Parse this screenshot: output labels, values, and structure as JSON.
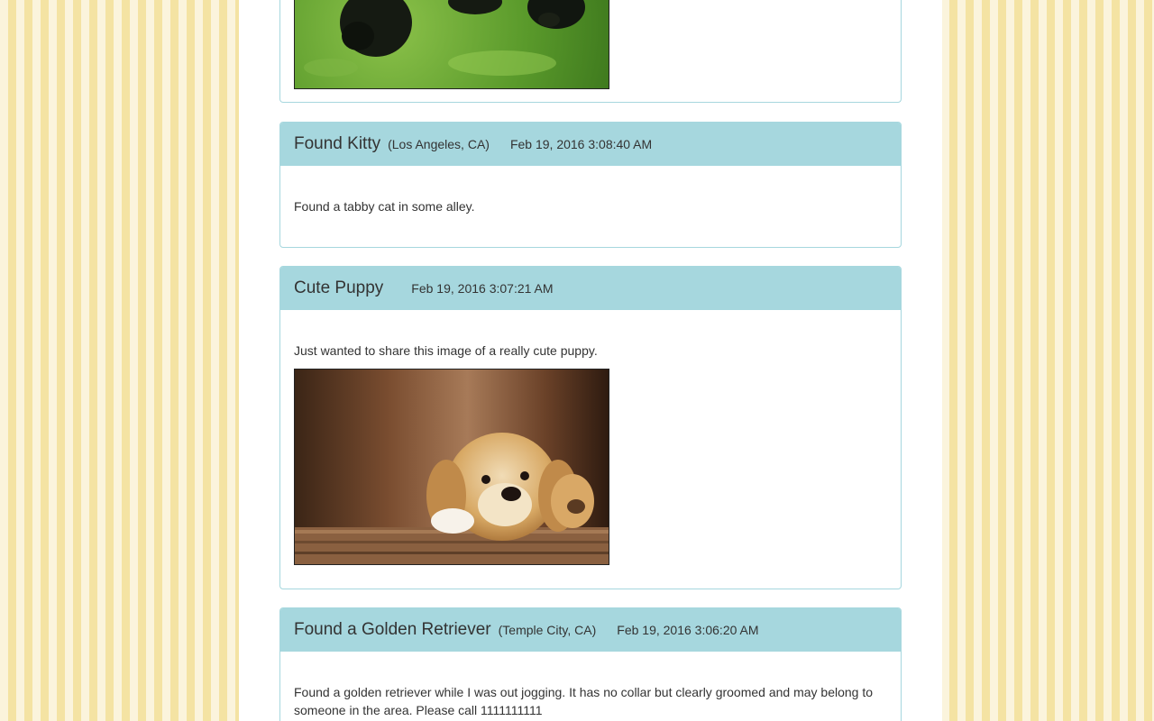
{
  "posts": [
    {
      "title": "",
      "location": "",
      "time": "",
      "text": "",
      "image": "black-puppies-on-grass-photo"
    },
    {
      "title": "Found Kitty",
      "location": "(Los Angeles, CA)",
      "time": "Feb 19, 2016 3:08:40 AM",
      "text": "Found a tabby cat in some alley."
    },
    {
      "title": "Cute Puppy",
      "location": "",
      "time": "Feb 19, 2016 3:07:21 AM",
      "text": "Just wanted to share this image of a really cute puppy.",
      "image": "golden-puppy-photo"
    },
    {
      "title": "Found a Golden Retriever",
      "location": "(Temple City, CA)",
      "time": "Feb 19, 2016 3:06:20 AM",
      "text": "Found a golden retriever while I was out jogging. It has no collar but clearly groomed and may belong to someone in the area. Please call 1111111111"
    }
  ],
  "colors": {
    "panel_header": "#a6d7de",
    "stripe_light": "#fbf4dc",
    "stripe_dark": "#f4e3a3"
  }
}
